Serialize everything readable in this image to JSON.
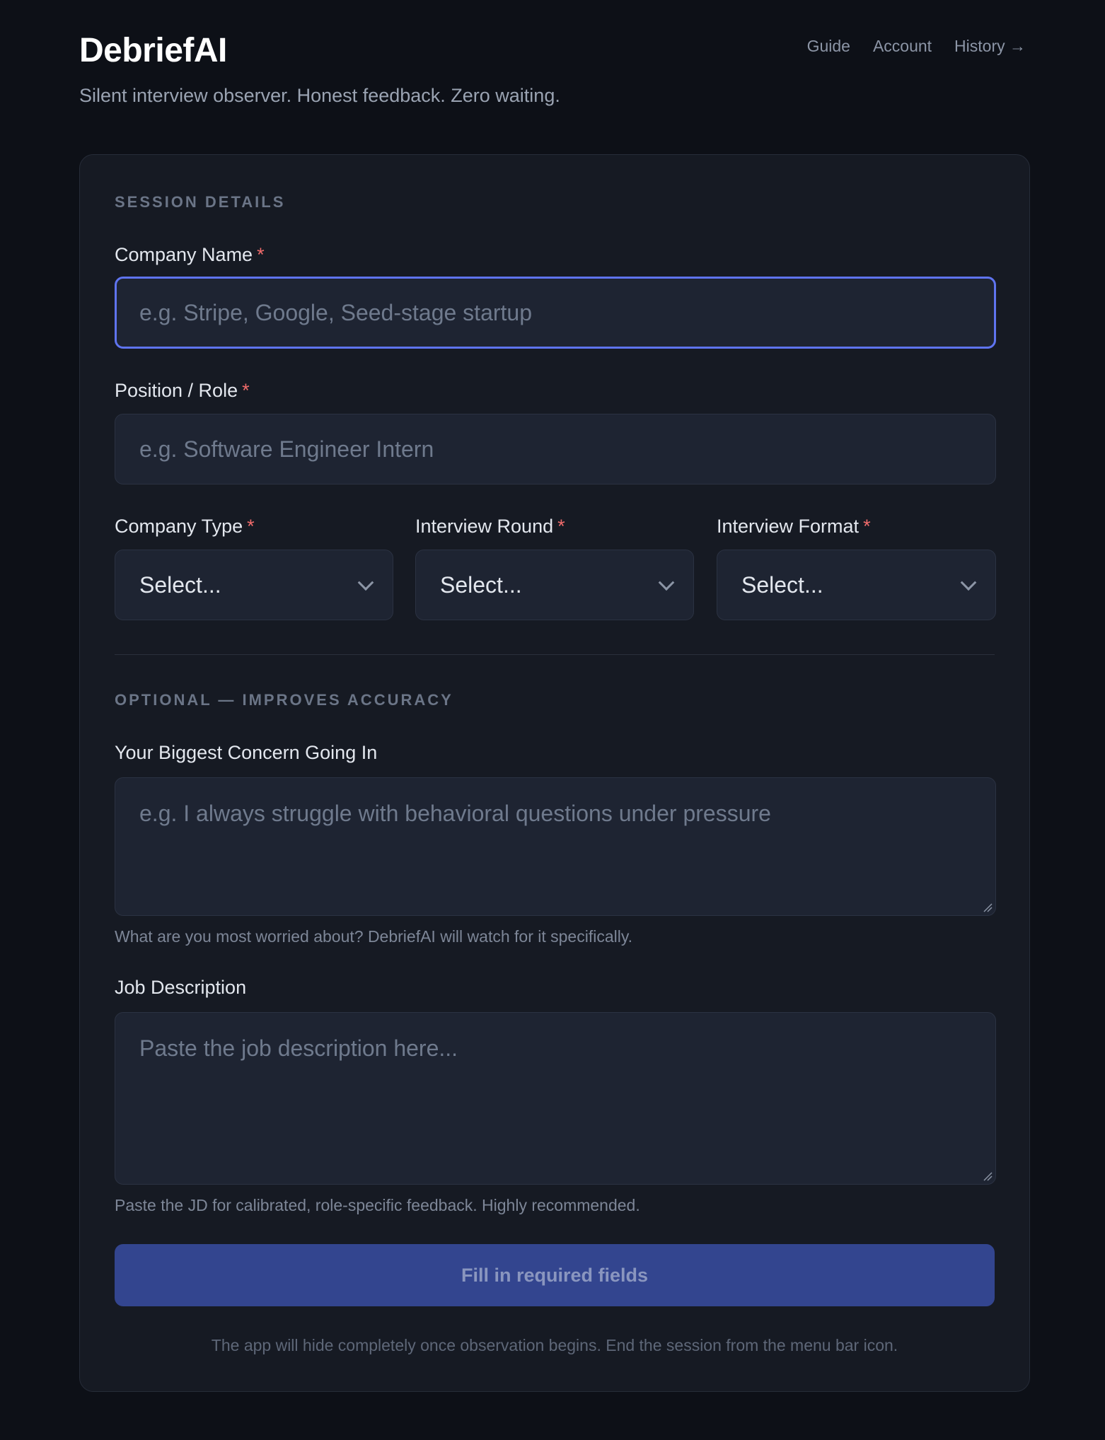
{
  "app": {
    "title": "DebriefAI",
    "tagline": "Silent interview observer. Honest feedback. Zero waiting."
  },
  "nav": {
    "guide": "Guide",
    "account": "Account",
    "history": "History →"
  },
  "session": {
    "title": "SESSION DETAILS",
    "company_name": {
      "label": "Company Name",
      "required": "*",
      "placeholder": "e.g. Stripe, Google, Seed-stage startup",
      "value": ""
    },
    "position": {
      "label": "Position / Role",
      "required": "*",
      "placeholder": "e.g. Software Engineer Intern",
      "value": ""
    },
    "company_type": {
      "label": "Company Type",
      "required": "*",
      "value": "Select..."
    },
    "interview_round": {
      "label": "Interview Round",
      "required": "*",
      "value": "Select..."
    },
    "interview_format": {
      "label": "Interview Format",
      "required": "*",
      "value": "Select..."
    }
  },
  "optional": {
    "title": "OPTIONAL — IMPROVES ACCURACY",
    "concern": {
      "label": "Your Biggest Concern Going In",
      "placeholder": "e.g. I always struggle with behavioral questions under pressure",
      "hint": "What are you most worried about? DebriefAI will watch for it specifically."
    },
    "job_description": {
      "label": "Job Description",
      "placeholder": "Paste the job description here...",
      "hint": "Paste the JD for calibrated, role-specific feedback. Highly recommended."
    }
  },
  "submit": {
    "label": "Fill in required fields"
  },
  "footnote": "The app will hide completely once observation begins. End the session from the menu bar icon.",
  "colors": {
    "background": "#0d1017",
    "card": "#161a23",
    "input": "#1e2432",
    "focus_border": "#5f74f0",
    "required": "#ef6b6b",
    "button": "#33458f"
  }
}
